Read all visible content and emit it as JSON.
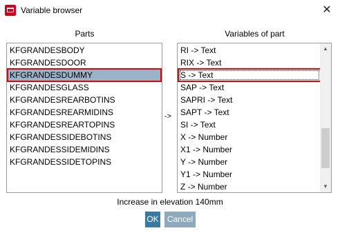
{
  "window": {
    "title": "Variable browser",
    "icon": "app-icon",
    "close_glyph": "✕"
  },
  "parts": {
    "header": "Parts",
    "items": [
      "KFGRANDESBODY",
      "KFGRANDESDOOR",
      "KFGRANDESDUMMY",
      "KFGRANDESGLASS",
      "KFGRANDESREARBOTINS",
      "KFGRANDESREARMIDINS",
      "KFGRANDESREARTOPINS",
      "KFGRANDESSIDEBOTINS",
      "KFGRANDESSIDEMIDINS",
      "KFGRANDESSIDETOPINS"
    ],
    "selected_index": 2
  },
  "arrow": "->",
  "variables": {
    "header": "Variables of part",
    "items": [
      "RI -> Text",
      "RIX -> Text",
      "S -> Text",
      "SAP -> Text",
      "SAPRI -> Text",
      "SAPT -> Text",
      "SI -> Text",
      "X -> Number",
      "X1 -> Number",
      "Y -> Number",
      "Y1 -> Number",
      "Z -> Number"
    ],
    "selected_index": 2,
    "scroll_position": 0.85
  },
  "status": "Increase in elevation 140mm",
  "buttons": {
    "ok": "OK",
    "cancel": "Cancel"
  },
  "colors": {
    "selection_bg": "#9ab3c8",
    "highlight_border": "#e10000",
    "ok_bg": "#3a7aa0",
    "cancel_bg": "#8fa9bc",
    "app_icon": "#d0021b"
  }
}
